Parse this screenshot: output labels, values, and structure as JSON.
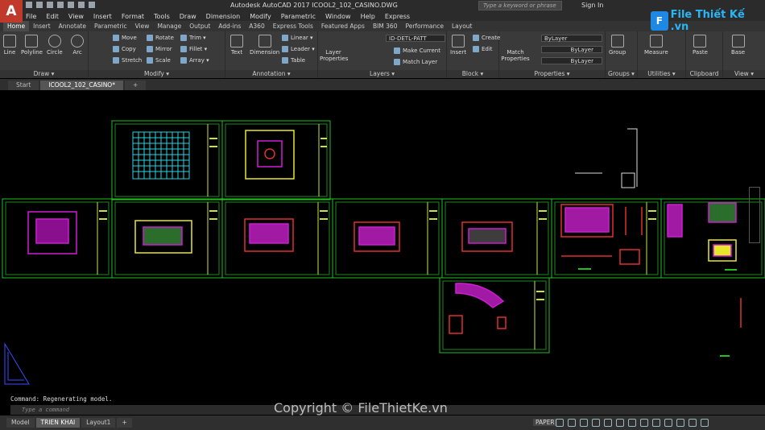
{
  "app": {
    "logo_letter": "A",
    "window_title": "Autodesk AutoCAD 2017    ICOOL2_102_CASINO.DWG",
    "search_placeholder": "Type a keyword or phrase",
    "signin_label": "Sign In"
  },
  "brand": {
    "logo_mark": "F",
    "logo_text": "File Thiết Kế .vn"
  },
  "menu": [
    "File",
    "Edit",
    "View",
    "Insert",
    "Format",
    "Tools",
    "Draw",
    "Dimension",
    "Modify",
    "Parametric",
    "Window",
    "Help",
    "Express"
  ],
  "ribbon_tabs": [
    "Home",
    "Insert",
    "Annotate",
    "Parametric",
    "View",
    "Manage",
    "Output",
    "Add-ins",
    "A360",
    "Express Tools",
    "Featured Apps",
    "BIM 360",
    "Performance",
    "Layout"
  ],
  "ribbon": {
    "draw": {
      "label": "Draw ▾",
      "tools": [
        "Line",
        "Polyline",
        "Circle",
        "Arc"
      ]
    },
    "modify": {
      "label": "Modify ▾",
      "tools": [
        "Move",
        "Rotate",
        "Trim ▾",
        "Copy",
        "Mirror",
        "Fillet ▾",
        "Stretch",
        "Scale",
        "Array ▾"
      ]
    },
    "annotation": {
      "label": "Annotation ▾",
      "tools": [
        "Text",
        "Dimension",
        "Linear ▾",
        "Leader ▾",
        "Table"
      ]
    },
    "layers": {
      "label": "Layers ▾",
      "current_layer": "ID-DETL-PATT",
      "layer_properties": "Layer Properties",
      "make_current": "Make Current",
      "match_layer": "Match Layer"
    },
    "block": {
      "label": "Block ▾",
      "insert": "Insert",
      "create": "Create",
      "edit": "Edit"
    },
    "properties": {
      "label": "Properties ▾",
      "match": "Match Properties",
      "bylayer1": "ByLayer",
      "bylayer2": "ByLayer",
      "bylayer3": "ByLayer"
    },
    "groups": {
      "label": "Groups ▾",
      "group": "Group"
    },
    "utilities": {
      "label": "Utilities ▾",
      "measure": "Measure"
    },
    "clipboard": {
      "label": "Clipboard",
      "paste": "Paste"
    },
    "view": {
      "label": "View ▾",
      "base": "Base"
    }
  },
  "doc_tabs": [
    "Start",
    "ICOOL2_102_CASINO*",
    "+"
  ],
  "command": {
    "history": "Command: Regenerating model.",
    "placeholder": "Type a command"
  },
  "watermark": "Copyright © FileThietKe.vn",
  "layout_tabs": [
    "Model",
    "TRIEN KHAI",
    "Layout1",
    "+"
  ],
  "status": {
    "paper": "PAPER"
  },
  "colors": {
    "sheet_border": "#21c21e",
    "magenta": "#d11ad6",
    "yellow": "#e8e82a",
    "red": "#e03030",
    "cyan": "#2ad4e0"
  }
}
